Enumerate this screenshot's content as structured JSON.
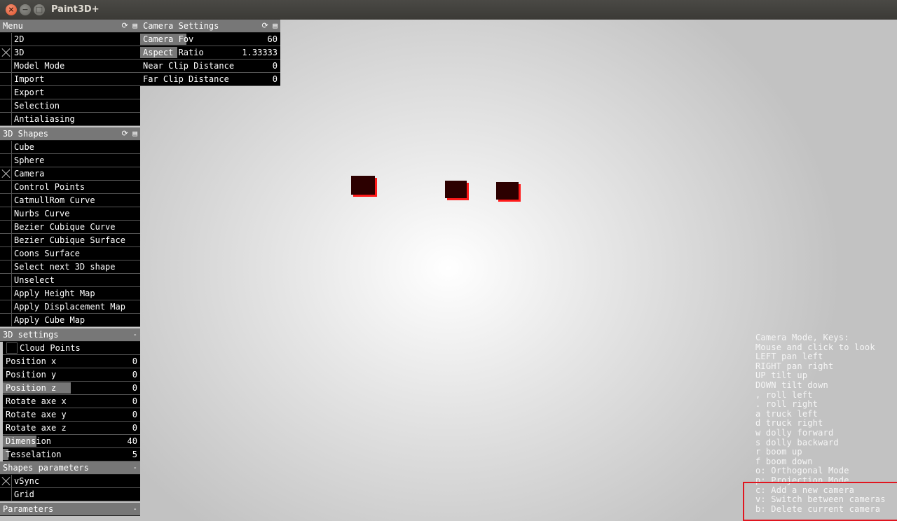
{
  "window": {
    "title": "Paint3D+",
    "close_glyph": "×",
    "min_glyph": "−",
    "max_glyph": "□"
  },
  "panel_controls": {
    "reset_icon": "⟳",
    "save_icon": "▤",
    "collapse_icon": "-"
  },
  "menu": {
    "title": "Menu",
    "items": [
      {
        "label": "2D",
        "checked": false
      },
      {
        "label": "3D",
        "checked": true
      },
      {
        "label": "Model Mode",
        "checked": false
      },
      {
        "label": "Import",
        "checked": false
      },
      {
        "label": "Export",
        "checked": false
      },
      {
        "label": "Selection",
        "checked": false
      },
      {
        "label": "Antialiasing",
        "checked": false
      }
    ]
  },
  "camera_settings": {
    "title": "Camera Settings",
    "rows": [
      {
        "label": "Camera Fov",
        "value": "60"
      },
      {
        "label": "Aspect Ratio",
        "value": "1.33333"
      },
      {
        "label": "Near Clip Distance",
        "value": "0"
      },
      {
        "label": "Far Clip Distance",
        "value": "0"
      }
    ]
  },
  "shapes_3d": {
    "title": "3D Shapes",
    "items": [
      {
        "label": "Cube",
        "checked": false
      },
      {
        "label": "Sphere",
        "checked": false
      },
      {
        "label": "Camera",
        "checked": true
      },
      {
        "label": "Control Points",
        "checked": false
      },
      {
        "label": "CatmullRom Curve",
        "checked": false
      },
      {
        "label": "Nurbs Curve",
        "checked": false
      },
      {
        "label": "Bezier Cubique Curve",
        "checked": false
      },
      {
        "label": "Bezier Cubique Surface",
        "checked": false
      },
      {
        "label": "Coons Surface",
        "checked": false
      },
      {
        "label": "Select next 3D shape",
        "checked": false
      },
      {
        "label": "Unselect",
        "checked": false
      },
      {
        "label": "Apply Height Map",
        "checked": false
      },
      {
        "label": "Apply Displacement Map",
        "checked": false
      },
      {
        "label": "Apply Cube Map",
        "checked": false
      }
    ]
  },
  "settings_3d": {
    "title": "3D settings",
    "cloud_points": {
      "label": "Cloud Points",
      "checked": false
    },
    "rows": [
      {
        "label": "Position x",
        "value": "0"
      },
      {
        "label": "Position y",
        "value": "0"
      },
      {
        "label": "Position z",
        "value": "0"
      },
      {
        "label": "Rotate axe x",
        "value": "0"
      },
      {
        "label": "Rotate axe y",
        "value": "0"
      },
      {
        "label": "Rotate axe z",
        "value": "0"
      },
      {
        "label": "Dimension",
        "value": "40"
      },
      {
        "label": "Tesselation",
        "value": "5"
      }
    ]
  },
  "shapes_parameters": {
    "title": "Shapes parameters",
    "items": [
      {
        "label": "vSync",
        "checked": true
      },
      {
        "label": "Grid",
        "checked": false
      }
    ]
  },
  "parameters": {
    "title": "Parameters"
  },
  "camera_help": {
    "lines": [
      "Camera Mode, Keys:",
      "Mouse and click to look",
      "LEFT pan left",
      "RIGHT pan right",
      "UP tilt up",
      "DOWN tilt down",
      ", roll left",
      ". roll right",
      "a truck left",
      "d truck right",
      "w dolly forward",
      "s dolly backward",
      "r boom up",
      "f boom down",
      "o: Orthogonal Mode",
      "p: Projection Mode",
      "c: Add a new camera",
      "v: Switch between cameras",
      "b: Delete current camera"
    ]
  },
  "colors": {
    "cube_face": "#2c0000",
    "cube_edge": "#ff1a1a",
    "highlight_box": "#e0151f"
  }
}
